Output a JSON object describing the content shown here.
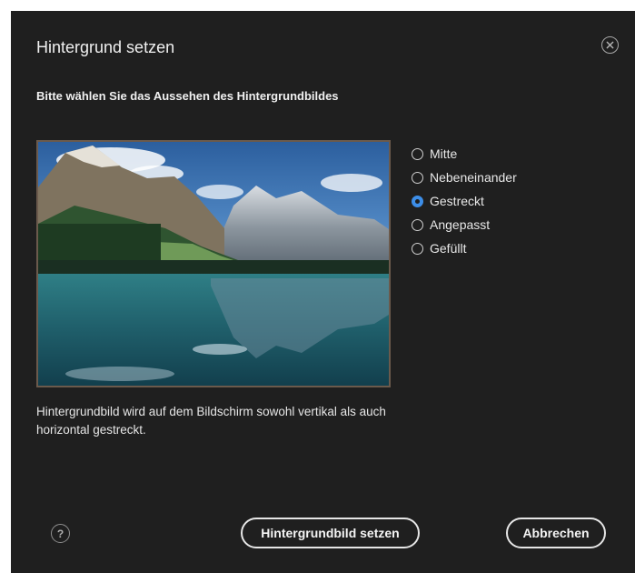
{
  "dialog": {
    "title": "Hintergrund setzen",
    "close_icon": "close-circle-icon",
    "subtitle": "Bitte wählen Sie das Aussehen des Hintergrundbildes",
    "preview_image": "mountain-lake-landscape",
    "options": [
      {
        "label": "Mitte",
        "selected": false
      },
      {
        "label": "Nebeneinander",
        "selected": false
      },
      {
        "label": "Gestreckt",
        "selected": true
      },
      {
        "label": "Angepasst",
        "selected": false
      },
      {
        "label": "Gefüllt",
        "selected": false
      }
    ],
    "description": "Hintergrundbild wird auf dem Bildschirm sowohl vertikal als auch horizontal gestreckt.",
    "help_icon": "help-circle-icon",
    "help_glyph": "?",
    "set_button_label": "Hintergrundbild setzen",
    "cancel_button_label": "Abbrechen"
  },
  "colors": {
    "background": "#1f1f1f",
    "text": "#f0f0f0",
    "radio_selected": "#3d8ee8",
    "button_border": "#e6e6e6",
    "preview_border": "#6b5a4c"
  }
}
